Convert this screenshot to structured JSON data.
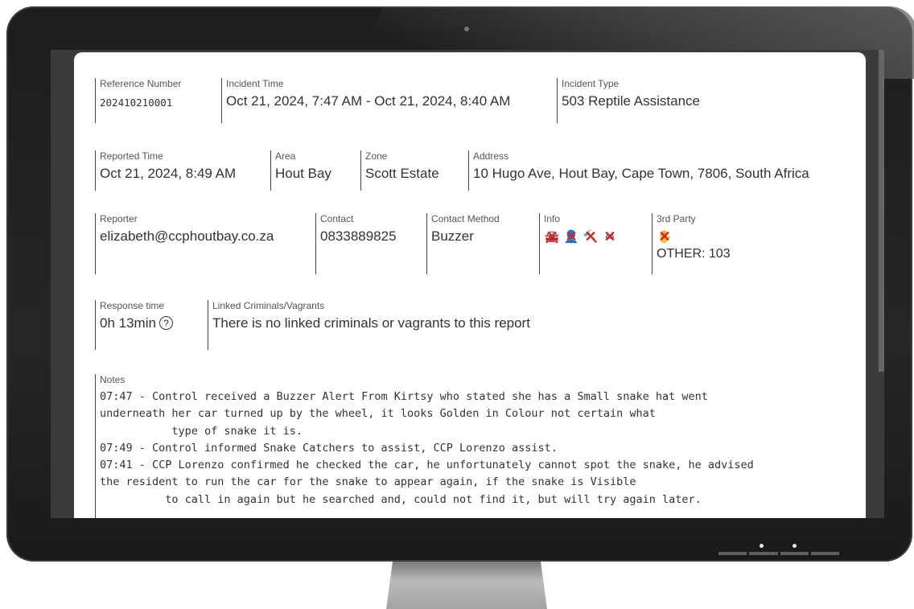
{
  "incident": {
    "reference_number": {
      "label": "Reference Number",
      "value": "202410210001"
    },
    "incident_time": {
      "label": "Incident Time",
      "value": "Oct 21, 2024, 7:47 AM - Oct 21, 2024, 8:40 AM"
    },
    "incident_type": {
      "label": "Incident Type",
      "value": "503 Reptile Assistance"
    },
    "reported_time": {
      "label": "Reported Time",
      "value": "Oct 21, 2024, 8:49 AM"
    },
    "area": {
      "label": "Area",
      "value": "Hout Bay"
    },
    "zone": {
      "label": "Zone",
      "value": "Scott Estate"
    },
    "address": {
      "label": "Address",
      "value": "10 Hugo Ave, Hout Bay, Cape Town, 7806, South Africa"
    },
    "reporter": {
      "label": "Reporter",
      "value": "elizabeth@ccphoutbay.co.za"
    },
    "contact": {
      "label": "Contact",
      "value": "0833889825"
    },
    "contact_method": {
      "label": "Contact Method",
      "value": "Buzzer"
    },
    "info": {
      "label": "Info",
      "icons": [
        "vehicle-crossed-icon",
        "person-crossed-icon",
        "weapon-crossed-icon",
        "handcuffs-crossed-icon"
      ]
    },
    "third_party": {
      "label": "3rd Party",
      "icon": "hand-crossed-icon",
      "value": "OTHER: 103"
    },
    "response_time": {
      "label": "Response time",
      "value": "0h 13min",
      "help_glyph": "?"
    },
    "linked": {
      "label": "Linked Criminals/Vagrants",
      "value": "There is no linked criminals or vagrants to this report"
    },
    "notes": {
      "label": "Notes",
      "text": "07:47 - Control received a Buzzer Alert From Kirtsy who stated she has a Small snake hat went\nunderneath her car turned up by the wheel, it looks Golden in Colour not certain what\n           type of snake it is.\n07:49 - Control informed Snake Catchers to assist, CCP Lorenzo assist.\n07:41 - CCP Lorenzo confirmed he checked the car, he unfortunately cannot spot the snake, he advised\nthe resident to run the car for the snake to appear again, if the snake is Visible\n          to call in again but he searched and, could not find it, but will try again later."
    }
  },
  "colors": {
    "cross": "#cc2a2a",
    "bezel": "#1f1f1f",
    "screen_bg": "#3b3b3b"
  }
}
